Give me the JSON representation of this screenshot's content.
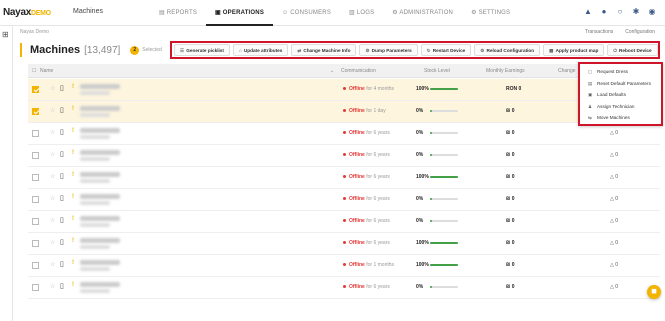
{
  "app": {
    "logo_brand": "Nayax",
    "logo_env": "DEMO",
    "page_label": "Machines"
  },
  "nav": [
    {
      "label": "REPORTS"
    },
    {
      "label": "OPERATIONS"
    },
    {
      "label": "CONSUMERS"
    },
    {
      "label": "LOGS"
    },
    {
      "label": "ADMINISTRATION"
    },
    {
      "label": "SETTINGS"
    }
  ],
  "breadcrumb": "Nayax Demo",
  "links": {
    "transactions": "Transactions",
    "configuration": "Configuration"
  },
  "header": {
    "title": "Machines",
    "count": "[13,497]",
    "selected_count": "2",
    "selected_label": "Selected"
  },
  "toolbar": [
    {
      "label": "Generate picklist",
      "icon": "list-icon"
    },
    {
      "label": "Update attributes",
      "icon": "tag-icon"
    },
    {
      "label": "Change Machine Info",
      "icon": "swap-icon"
    },
    {
      "label": "Dump Parameters",
      "icon": "gear-icon"
    },
    {
      "label": "Restart Device",
      "icon": "refresh-icon"
    },
    {
      "label": "Reload Configuration",
      "icon": "gear-icon"
    },
    {
      "label": "Apply product map",
      "icon": "map-icon"
    },
    {
      "label": "Reboot Device",
      "icon": "power-icon"
    }
  ],
  "columns": {
    "name": "Name",
    "communication": "Communication",
    "stock": "Stock Level",
    "earnings": "Monthly Earnings",
    "changes": "Change"
  },
  "rows": [
    {
      "selected": true,
      "status": "Offline",
      "since": "for 4 months",
      "stock": "100%",
      "stock_fill": 1.0,
      "earnings": "RON 0",
      "changes": ""
    },
    {
      "selected": true,
      "status": "Offline",
      "since": "for 1 day",
      "stock": "0%",
      "stock_fill": 0.0,
      "earnings": "₪ 0",
      "changes": ""
    },
    {
      "selected": false,
      "status": "Offline",
      "since": "for 6 years",
      "stock": "0%",
      "stock_fill": 0.0,
      "earnings": "₪ 0",
      "changes": "0"
    },
    {
      "selected": false,
      "status": "Offline",
      "since": "for 6 years",
      "stock": "0%",
      "stock_fill": 0.0,
      "earnings": "₪ 0",
      "changes": "0"
    },
    {
      "selected": false,
      "status": "Offline",
      "since": "for 6 years",
      "stock": "100%",
      "stock_fill": 1.0,
      "earnings": "₪ 0",
      "changes": "0"
    },
    {
      "selected": false,
      "status": "Offline",
      "since": "for 6 years",
      "stock": "0%",
      "stock_fill": 0.0,
      "earnings": "₪ 0",
      "changes": "0"
    },
    {
      "selected": false,
      "status": "Offline",
      "since": "for 6 years",
      "stock": "0%",
      "stock_fill": 0.0,
      "earnings": "₪ 0",
      "changes": "0"
    },
    {
      "selected": false,
      "status": "Offline",
      "since": "for 6 years",
      "stock": "100%",
      "stock_fill": 1.0,
      "earnings": "₪ 0",
      "changes": "0"
    },
    {
      "selected": false,
      "status": "Offline",
      "since": "for 1 months",
      "stock": "100%",
      "stock_fill": 1.0,
      "earnings": "₪ 0",
      "changes": "0"
    },
    {
      "selected": false,
      "status": "Offline",
      "since": "for 6 years",
      "stock": "0%",
      "stock_fill": 0.0,
      "earnings": "₪ 0",
      "changes": "0"
    }
  ],
  "menu": [
    {
      "label": "Request Dress",
      "icon": "request-icon"
    },
    {
      "label": "Reset Default Parameters",
      "icon": "reset-icon"
    },
    {
      "label": "Load Defaults",
      "icon": "load-icon"
    },
    {
      "label": "Assign Technician",
      "icon": "user-icon"
    },
    {
      "label": "Move Machines",
      "icon": "move-icon"
    }
  ],
  "colors": {
    "accent": "#f2b400",
    "highlight_border": "#d0142a",
    "offline": "#e53935",
    "stock_bar": "#43a047"
  }
}
